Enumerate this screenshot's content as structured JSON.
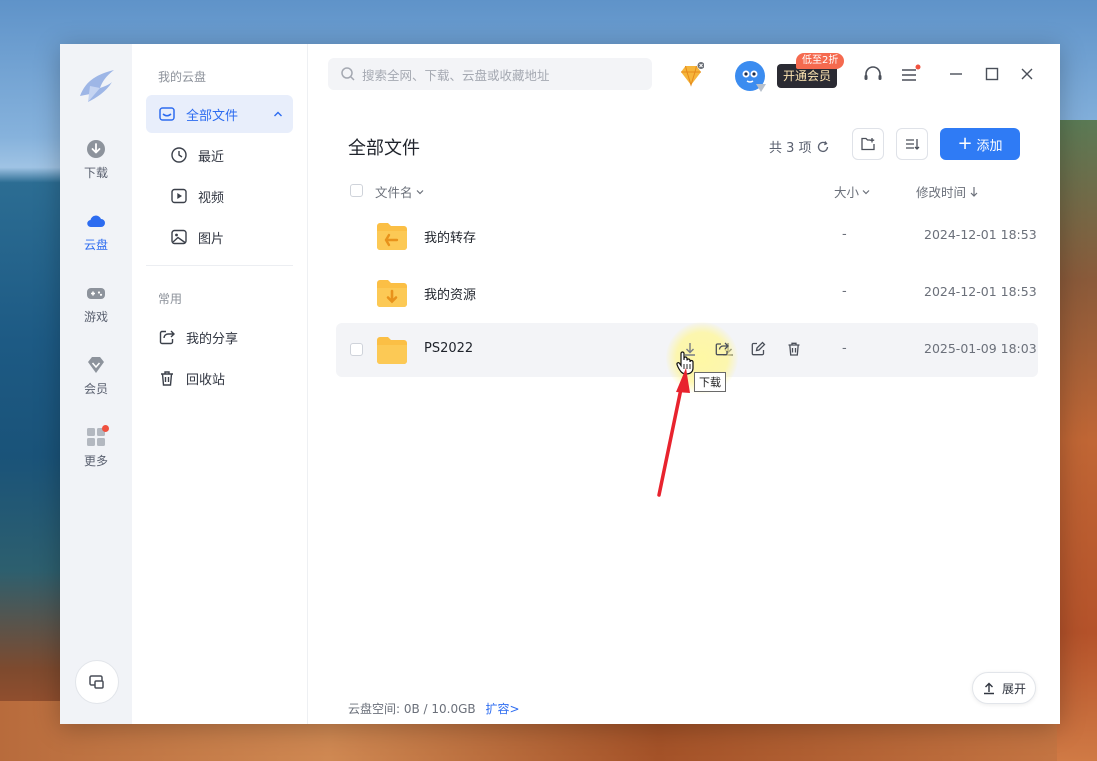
{
  "rail": {
    "items": [
      {
        "label": "下载",
        "icon": "download-circle-icon"
      },
      {
        "label": "云盘",
        "icon": "cloud-icon"
      },
      {
        "label": "游戏",
        "icon": "gamepad-icon"
      },
      {
        "label": "会员",
        "icon": "diamond-icon"
      },
      {
        "label": "更多",
        "icon": "apps-grid-icon"
      }
    ]
  },
  "nav": {
    "section_cloud": "我的云盘",
    "all_files": "全部文件",
    "recent": "最近",
    "videos": "视频",
    "images": "图片",
    "section_common": "常用",
    "my_share": "我的分享",
    "recycle": "回收站"
  },
  "search": {
    "placeholder": "搜索全网、下载、云盘或收藏地址"
  },
  "vip": {
    "tag": "低至2折",
    "label": "开通会员"
  },
  "main": {
    "title": "全部文件",
    "count": "共 3 项",
    "add_label": "添加",
    "col_name": "文件名",
    "col_size": "大小",
    "col_time": "修改时间",
    "rows": [
      {
        "name": "我的转存",
        "size": "-",
        "time": "2024-12-01 18:53"
      },
      {
        "name": "我的资源",
        "size": "-",
        "time": "2024-12-01 18:53"
      },
      {
        "name": "PS2022",
        "size": "-",
        "time": "2025-01-09 18:03"
      }
    ],
    "tooltip": "下载",
    "quota_label": "云盘空间:",
    "quota_value": "0B / 10.0GB",
    "quota_link": "扩容>",
    "expand_label": "展开"
  },
  "colors": {
    "accent": "#2f7bf5",
    "folder": "#fbbf45",
    "annotation": "#e8232e"
  }
}
